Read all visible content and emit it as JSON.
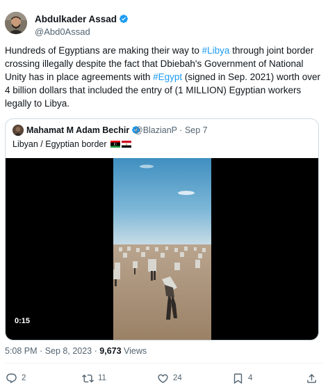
{
  "author": {
    "name": "Abdulkader Assad",
    "handle": "@Abd0Assad"
  },
  "tweet": {
    "segments": [
      "Hundreds of Egyptians are making their way to ",
      "#Libya",
      " through joint border crossing illegally despite the fact that Dbiebah's Government of National Unity has in place agreements with ",
      "#Egypt",
      " (signed in Sep. 2021) worth over 4 billion dollars that included the entry of (1 MILLION) Egyptian workers legally to Libya."
    ]
  },
  "quote": {
    "name": "Mahamat M Adam Bechir",
    "handle": "@BlazianP",
    "separator": "·",
    "date": "Sep 7",
    "text": "Libyan / Egyptian border",
    "flags": [
      "flag-libya",
      "flag-egypt"
    ],
    "video_timestamp": "0:15"
  },
  "meta": {
    "time": "5:08 PM",
    "separator": "·",
    "date": "Sep 8, 2023",
    "views_count": "9,673",
    "views_label": "Views"
  },
  "actions": {
    "reply_count": "2",
    "retweet_count": "11",
    "like_count": "24",
    "bookmark_count": "4"
  },
  "colors": {
    "link": "#1d9bf0",
    "text": "#0f1419",
    "secondary": "#536471",
    "border": "#cfd9de"
  },
  "icons": [
    "verified-badge-icon",
    "reply-icon",
    "retweet-icon",
    "like-icon",
    "bookmark-icon",
    "share-icon"
  ]
}
